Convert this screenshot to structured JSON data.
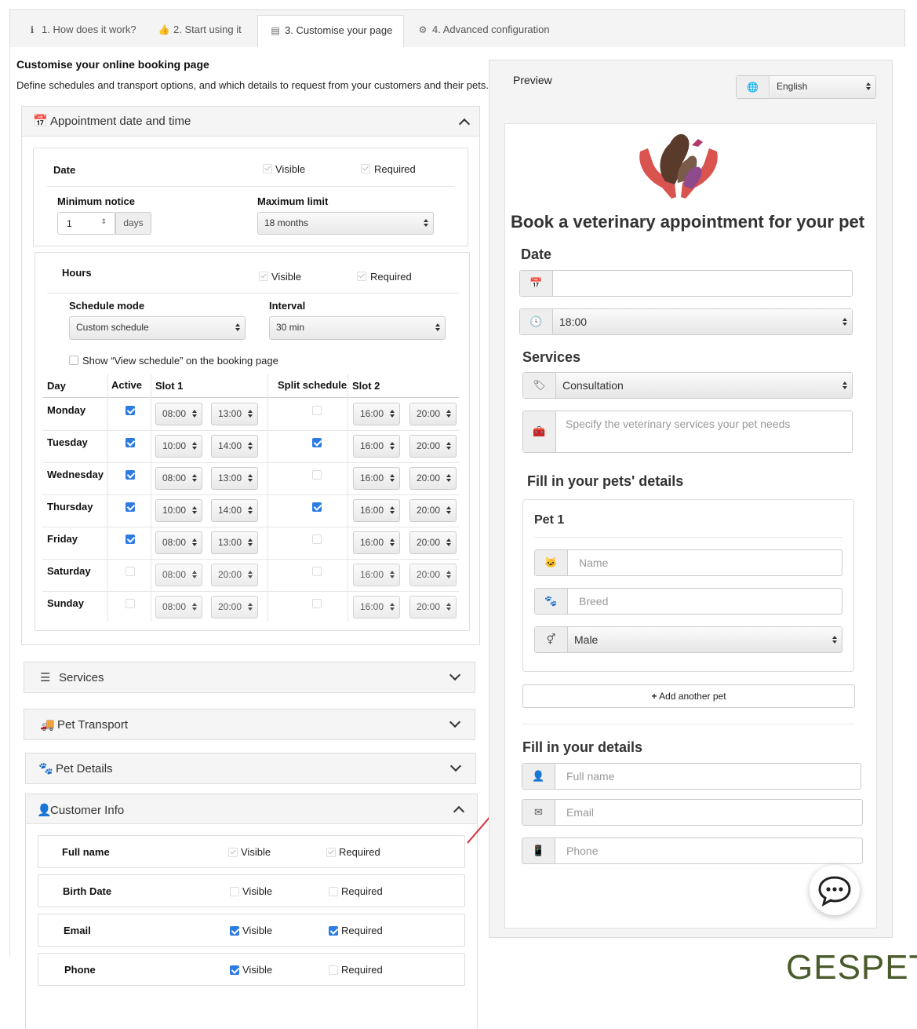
{
  "tabs": [
    {
      "icon": "info-icon",
      "label": "1. How does it work?"
    },
    {
      "icon": "thumbs-up-icon",
      "label": "2. Start using it"
    },
    {
      "icon": "layout-icon",
      "label": "3. Customise your page"
    },
    {
      "icon": "gears-icon",
      "label": "4. Advanced configuration"
    }
  ],
  "header": {
    "title": "Customise your online booking page",
    "description": "Define schedules and transport options, and which details to request from your customers and their pets."
  },
  "appointment": {
    "title": "Appointment date and time",
    "date": {
      "label": "Date",
      "visible": "Visible",
      "required": "Required",
      "min_notice_label": "Minimum notice",
      "min_notice_value": "1",
      "min_notice_unit": "days",
      "max_limit_label": "Maximum limit",
      "max_limit_value": "18 months"
    },
    "hours": {
      "label": "Hours",
      "visible": "Visible",
      "required": "Required",
      "schedule_mode_label": "Schedule mode",
      "schedule_mode_value": "Custom schedule",
      "interval_label": "Interval",
      "interval_value": "30 min",
      "show_schedule_label": "Show “View schedule” on the booking page"
    },
    "table": {
      "headers": [
        "Day",
        "Active",
        "Slot 1",
        "Split schedule",
        "Slot 2"
      ],
      "rows": [
        {
          "day": "Monday",
          "active": true,
          "s1a": "08:00",
          "s1b": "13:00",
          "split": false,
          "s2a": "16:00",
          "s2b": "20:00"
        },
        {
          "day": "Tuesday",
          "active": true,
          "s1a": "10:00",
          "s1b": "14:00",
          "split": true,
          "s2a": "16:00",
          "s2b": "20:00"
        },
        {
          "day": "Wednesday",
          "active": true,
          "s1a": "08:00",
          "s1b": "13:00",
          "split": false,
          "s2a": "16:00",
          "s2b": "20:00"
        },
        {
          "day": "Thursday",
          "active": true,
          "s1a": "10:00",
          "s1b": "14:00",
          "split": true,
          "s2a": "16:00",
          "s2b": "20:00"
        },
        {
          "day": "Friday",
          "active": true,
          "s1a": "08:00",
          "s1b": "13:00",
          "split": false,
          "s2a": "16:00",
          "s2b": "20:00"
        },
        {
          "day": "Saturday",
          "active": false,
          "s1a": "08:00",
          "s1b": "20:00",
          "split": false,
          "s2a": "16:00",
          "s2b": "20:00"
        },
        {
          "day": "Sunday",
          "active": false,
          "s1a": "08:00",
          "s1b": "20:00",
          "split": false,
          "s2a": "16:00",
          "s2b": "20:00"
        }
      ]
    }
  },
  "collapsed_panels": [
    {
      "icon": "list-icon",
      "title": "Services"
    },
    {
      "icon": "truck-icon",
      "title": "Pet Transport"
    },
    {
      "icon": "paw-icon",
      "title": "Pet Details"
    }
  ],
  "customer_info": {
    "title": "Customer Info",
    "rows": [
      {
        "label": "Full name",
        "visible": "Visible",
        "required": "Required",
        "visible_on": true,
        "required_on": true,
        "locked": true
      },
      {
        "label": "Birth Date",
        "visible": "Visible",
        "required": "Required",
        "visible_on": false,
        "required_on": false,
        "locked": false
      },
      {
        "label": "Email",
        "visible": "Visible",
        "required": "Required",
        "visible_on": true,
        "required_on": true,
        "locked": false
      },
      {
        "label": "Phone",
        "visible": "Visible",
        "required": "Required",
        "visible_on": true,
        "required_on": false,
        "locked": false
      }
    ]
  },
  "preview": {
    "label": "Preview",
    "language": "English",
    "booking_title": "Book a veterinary  appointment for your pet",
    "date_heading": "Date",
    "time_value": "18:00",
    "services_heading": "Services",
    "service_value": "Consultation",
    "services_placeholder": "Specify the veterinary services your pet needs",
    "pets_heading": "Fill in your pets' details",
    "pet_title": "Pet 1",
    "pet_name_placeholder": "Name",
    "pet_breed_placeholder": "Breed",
    "pet_sex_value": "Male",
    "add_pet_label": "Add another pet",
    "details_heading": "Fill in your details",
    "fullname_placeholder": "Full name",
    "email_placeholder": "Email",
    "phone_placeholder": "Phone"
  },
  "brand": "GESPET",
  "colors": {
    "accent": "#2c7be5",
    "brand": "#4a5a2a",
    "arrow": "#d62b35",
    "logo": "#d9534f"
  }
}
